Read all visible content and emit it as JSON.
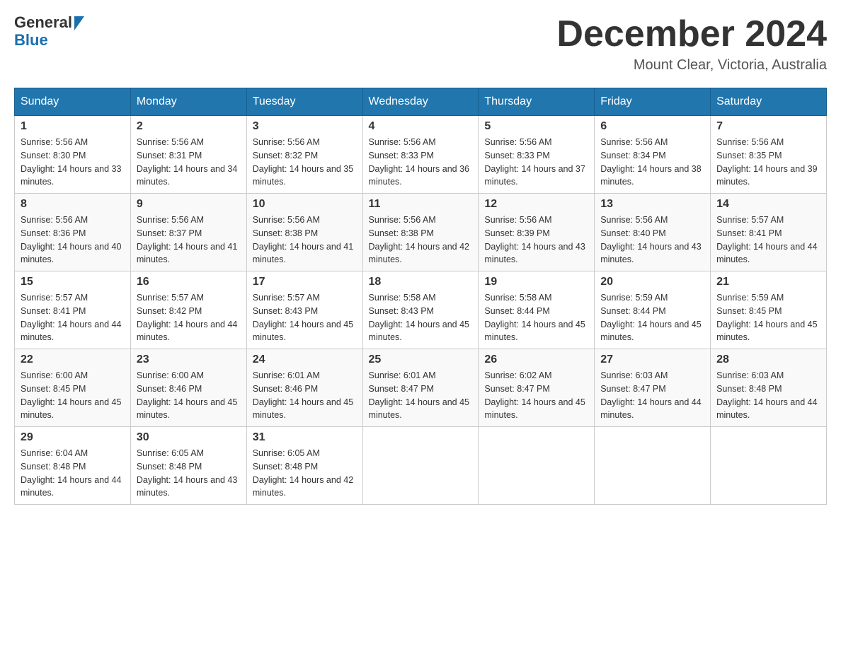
{
  "logo": {
    "line1": "General",
    "line2": "Blue"
  },
  "header": {
    "month": "December 2024",
    "location": "Mount Clear, Victoria, Australia"
  },
  "days_of_week": [
    "Sunday",
    "Monday",
    "Tuesday",
    "Wednesday",
    "Thursday",
    "Friday",
    "Saturday"
  ],
  "weeks": [
    [
      {
        "day": "1",
        "sunrise": "5:56 AM",
        "sunset": "8:30 PM",
        "daylight": "14 hours and 33 minutes."
      },
      {
        "day": "2",
        "sunrise": "5:56 AM",
        "sunset": "8:31 PM",
        "daylight": "14 hours and 34 minutes."
      },
      {
        "day": "3",
        "sunrise": "5:56 AM",
        "sunset": "8:32 PM",
        "daylight": "14 hours and 35 minutes."
      },
      {
        "day": "4",
        "sunrise": "5:56 AM",
        "sunset": "8:33 PM",
        "daylight": "14 hours and 36 minutes."
      },
      {
        "day": "5",
        "sunrise": "5:56 AM",
        "sunset": "8:33 PM",
        "daylight": "14 hours and 37 minutes."
      },
      {
        "day": "6",
        "sunrise": "5:56 AM",
        "sunset": "8:34 PM",
        "daylight": "14 hours and 38 minutes."
      },
      {
        "day": "7",
        "sunrise": "5:56 AM",
        "sunset": "8:35 PM",
        "daylight": "14 hours and 39 minutes."
      }
    ],
    [
      {
        "day": "8",
        "sunrise": "5:56 AM",
        "sunset": "8:36 PM",
        "daylight": "14 hours and 40 minutes."
      },
      {
        "day": "9",
        "sunrise": "5:56 AM",
        "sunset": "8:37 PM",
        "daylight": "14 hours and 41 minutes."
      },
      {
        "day": "10",
        "sunrise": "5:56 AM",
        "sunset": "8:38 PM",
        "daylight": "14 hours and 41 minutes."
      },
      {
        "day": "11",
        "sunrise": "5:56 AM",
        "sunset": "8:38 PM",
        "daylight": "14 hours and 42 minutes."
      },
      {
        "day": "12",
        "sunrise": "5:56 AM",
        "sunset": "8:39 PM",
        "daylight": "14 hours and 43 minutes."
      },
      {
        "day": "13",
        "sunrise": "5:56 AM",
        "sunset": "8:40 PM",
        "daylight": "14 hours and 43 minutes."
      },
      {
        "day": "14",
        "sunrise": "5:57 AM",
        "sunset": "8:41 PM",
        "daylight": "14 hours and 44 minutes."
      }
    ],
    [
      {
        "day": "15",
        "sunrise": "5:57 AM",
        "sunset": "8:41 PM",
        "daylight": "14 hours and 44 minutes."
      },
      {
        "day": "16",
        "sunrise": "5:57 AM",
        "sunset": "8:42 PM",
        "daylight": "14 hours and 44 minutes."
      },
      {
        "day": "17",
        "sunrise": "5:57 AM",
        "sunset": "8:43 PM",
        "daylight": "14 hours and 45 minutes."
      },
      {
        "day": "18",
        "sunrise": "5:58 AM",
        "sunset": "8:43 PM",
        "daylight": "14 hours and 45 minutes."
      },
      {
        "day": "19",
        "sunrise": "5:58 AM",
        "sunset": "8:44 PM",
        "daylight": "14 hours and 45 minutes."
      },
      {
        "day": "20",
        "sunrise": "5:59 AM",
        "sunset": "8:44 PM",
        "daylight": "14 hours and 45 minutes."
      },
      {
        "day": "21",
        "sunrise": "5:59 AM",
        "sunset": "8:45 PM",
        "daylight": "14 hours and 45 minutes."
      }
    ],
    [
      {
        "day": "22",
        "sunrise": "6:00 AM",
        "sunset": "8:45 PM",
        "daylight": "14 hours and 45 minutes."
      },
      {
        "day": "23",
        "sunrise": "6:00 AM",
        "sunset": "8:46 PM",
        "daylight": "14 hours and 45 minutes."
      },
      {
        "day": "24",
        "sunrise": "6:01 AM",
        "sunset": "8:46 PM",
        "daylight": "14 hours and 45 minutes."
      },
      {
        "day": "25",
        "sunrise": "6:01 AM",
        "sunset": "8:47 PM",
        "daylight": "14 hours and 45 minutes."
      },
      {
        "day": "26",
        "sunrise": "6:02 AM",
        "sunset": "8:47 PM",
        "daylight": "14 hours and 45 minutes."
      },
      {
        "day": "27",
        "sunrise": "6:03 AM",
        "sunset": "8:47 PM",
        "daylight": "14 hours and 44 minutes."
      },
      {
        "day": "28",
        "sunrise": "6:03 AM",
        "sunset": "8:48 PM",
        "daylight": "14 hours and 44 minutes."
      }
    ],
    [
      {
        "day": "29",
        "sunrise": "6:04 AM",
        "sunset": "8:48 PM",
        "daylight": "14 hours and 44 minutes."
      },
      {
        "day": "30",
        "sunrise": "6:05 AM",
        "sunset": "8:48 PM",
        "daylight": "14 hours and 43 minutes."
      },
      {
        "day": "31",
        "sunrise": "6:05 AM",
        "sunset": "8:48 PM",
        "daylight": "14 hours and 42 minutes."
      },
      null,
      null,
      null,
      null
    ]
  ],
  "labels": {
    "sunrise_prefix": "Sunrise: ",
    "sunset_prefix": "Sunset: ",
    "daylight_prefix": "Daylight: "
  }
}
